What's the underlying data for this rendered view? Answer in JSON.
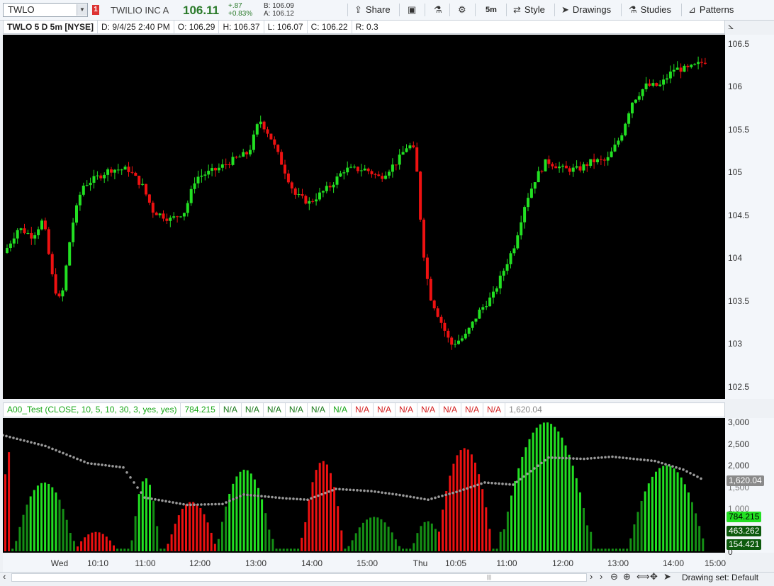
{
  "toolbar": {
    "symbol": "TWLO",
    "alert_count": "1",
    "company": "TWILIO INC A",
    "last": "106.11",
    "change": "+.87",
    "change_pct": "+0.83%",
    "bid": "B: 106.09",
    "ask": "A: 106.12",
    "share": "Share",
    "timeframe": "5m",
    "style": "Style",
    "drawings": "Drawings",
    "studies": "Studies",
    "patterns": "Patterns"
  },
  "header": {
    "symbol": "TWLO 5 D 5m [NYSE]",
    "date": "D: 9/4/25 2:40 PM",
    "open": "O: 106.29",
    "high": "H: 106.37",
    "low": "L: 106.07",
    "close": "C: 106.22",
    "range": "R: 0.3"
  },
  "price_axis": [
    "106.5",
    "106",
    "105.5",
    "105",
    "104.5",
    "104",
    "103.5",
    "103",
    "102.5"
  ],
  "study": {
    "name": "A00_Test (CLOSE, 10, 5, 10, 30, 3, yes, yes)",
    "value": "784.215",
    "na_green": [
      "N/A",
      "N/A",
      "N/A",
      "N/A",
      "N/A",
      "N/A"
    ],
    "na_red": [
      "N/A",
      "N/A",
      "N/A",
      "N/A",
      "N/A",
      "N/A",
      "N/A"
    ],
    "avg": "1,620.04",
    "axis": [
      "3,000",
      "2,500",
      "2,000",
      "1,500",
      "1,000",
      "500",
      "0"
    ],
    "bubbles": {
      "avg": "1,620.04",
      "main": "784.215",
      "mid": "463.262",
      "low": "154.421"
    }
  },
  "time_axis": [
    "Wed",
    "10:10",
    "11:00",
    "12:00",
    "13:00",
    "14:00",
    "15:00",
    "Thu",
    "10:05",
    "11:00",
    "12:00",
    "13:00",
    "14:00",
    "15:00"
  ],
  "bottom": {
    "drawing_set": "Drawing set: Default"
  },
  "colors": {
    "up": "#22e022",
    "down": "#ee1111",
    "bg": "#000000",
    "avg_line": "#9a9a9a"
  }
}
